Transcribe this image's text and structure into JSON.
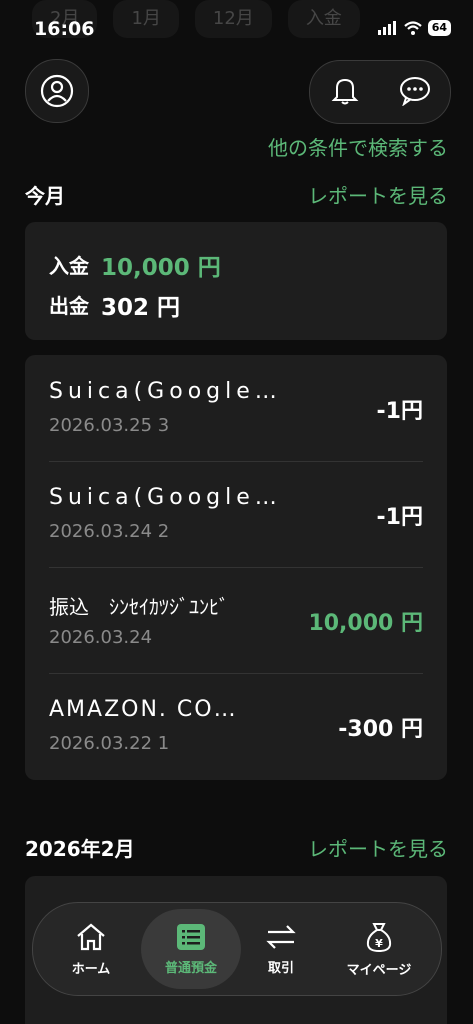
{
  "status": {
    "time": "16:06",
    "battery": "64"
  },
  "filter_chips": [
    "2月",
    "1月",
    "12月",
    "入金"
  ],
  "header": {
    "search_link": "他の条件で検索する"
  },
  "current_month": {
    "title": "今月",
    "report_link": "レポートを見る",
    "deposit_label": "入金",
    "deposit_value": "10,000 円",
    "withdraw_label": "出金",
    "withdraw_value": "302 円"
  },
  "transactions": [
    {
      "name": "Suica(Google…",
      "date": "2026.03.25  3",
      "amount": "-1円"
    },
    {
      "name": "Suica(Google…",
      "date": "2026.03.24  2",
      "amount": "-1円"
    },
    {
      "name": "振込　ｼﾝｾｲｶﾂｼﾞﾕﾝﾋﾞ",
      "date": "2026.03.24",
      "amount": "10,000 円"
    },
    {
      "name": "AMAZON. CO…",
      "date": "2026.03.22  1",
      "amount": "-300 円"
    }
  ],
  "prev_month": {
    "title": "2026年2月",
    "report_link": "レポートを見る"
  },
  "nav": [
    {
      "label": "ホーム",
      "icon": "home-icon"
    },
    {
      "label": "普通預金",
      "icon": "list-icon"
    },
    {
      "label": "取引",
      "icon": "transfer-icon"
    },
    {
      "label": "マイページ",
      "icon": "money-bag-icon"
    }
  ],
  "colors": {
    "accent": "#5cb878",
    "background": "#0d0d0d",
    "card": "#1e1e1e"
  }
}
